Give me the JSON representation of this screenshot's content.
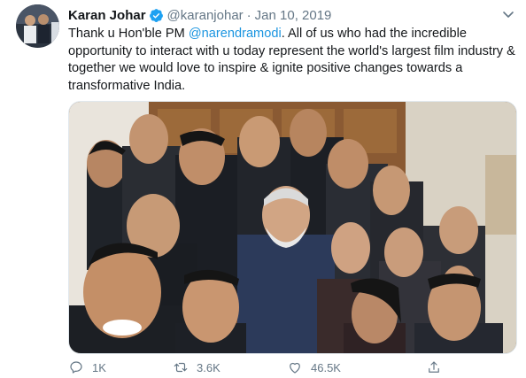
{
  "tweet": {
    "author_name": "Karan Johar",
    "handle": "@karanjohar",
    "separator": "·",
    "date": "Jan 10, 2019",
    "text_before": "Thank u Hon'ble PM ",
    "mention": "@narendramodi",
    "text_after": ". All of us who had the incredible opportunity to interact with u today represent the world's largest film industry & together we would love to inspire & ignite positive changes towards a transformative India."
  },
  "actions": {
    "reply_count": "1K",
    "retweet_count": "3.6K",
    "like_count": "46.5K"
  },
  "icons": {
    "verified": "verified-badge-icon",
    "caret": "chevron-down-icon",
    "reply": "reply-icon",
    "retweet": "retweet-icon",
    "like": "heart-icon",
    "share": "share-icon"
  },
  "colors": {
    "primary_text": "#14171a",
    "secondary_text": "#657786",
    "link": "#1b95e0",
    "verified": "#1da1f2"
  }
}
